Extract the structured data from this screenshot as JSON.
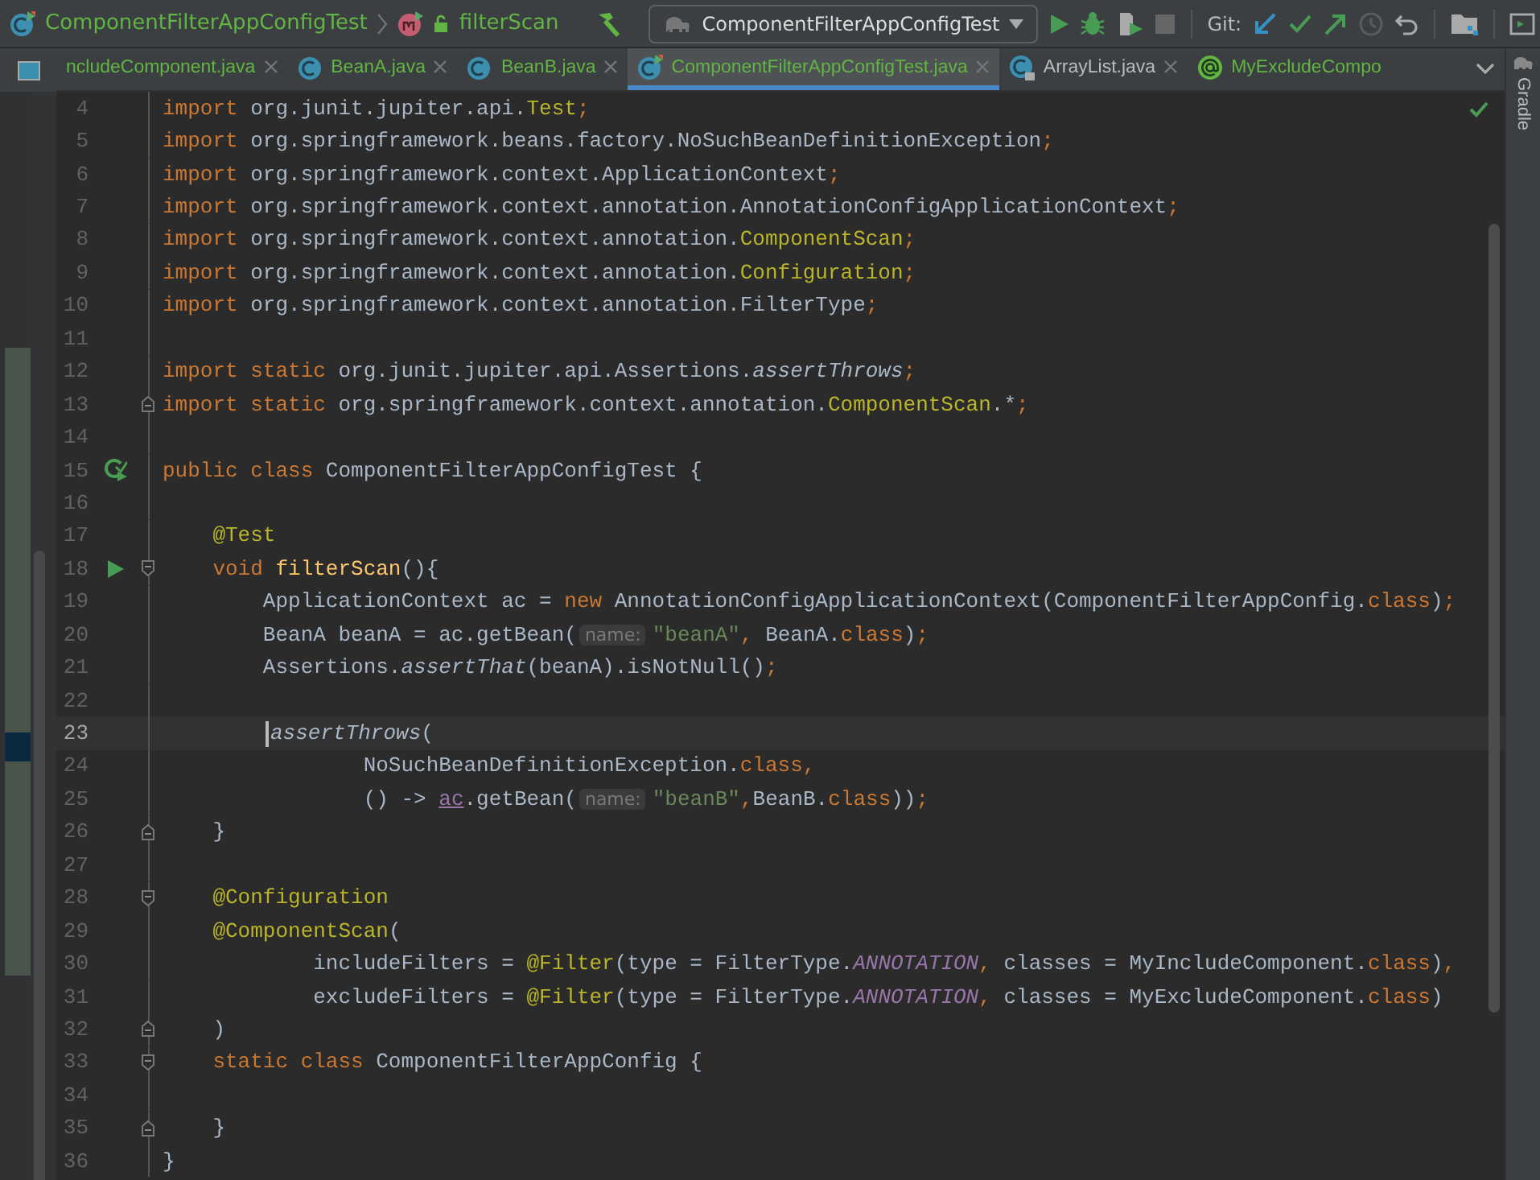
{
  "toolbar": {
    "breadcrumb": [
      {
        "kind": "class",
        "label": "ComponentFilterAppConfigTest"
      },
      {
        "kind": "method",
        "label": "filterScan"
      }
    ],
    "run_config": "ComponentFilterAppConfigTest",
    "git_label": "Git:"
  },
  "tabs": [
    {
      "label": "ncludeComponent.java",
      "selected": false,
      "kind": "plain"
    },
    {
      "label": "BeanA.java",
      "selected": false,
      "kind": "class"
    },
    {
      "label": "BeanB.java",
      "selected": false,
      "kind": "class"
    },
    {
      "label": "ComponentFilterAppConfigTest.java",
      "selected": true,
      "kind": "test"
    },
    {
      "label": "ArrayList.java",
      "selected": false,
      "kind": "library"
    },
    {
      "label": "MyExcludeCompo",
      "selected": false,
      "kind": "annotation"
    }
  ],
  "right_stripe": {
    "label": "Gradle"
  },
  "editor": {
    "lines": [
      {
        "number": "4",
        "tokens": [
          {
            "kind": "keyword",
            "text": "import "
          },
          {
            "kind": "plain",
            "text": "org.junit.jupiter.api."
          },
          {
            "kind": "annotation",
            "text": "Test"
          },
          {
            "kind": "keyword",
            "text": ";"
          }
        ]
      },
      {
        "number": "5",
        "tokens": [
          {
            "kind": "keyword",
            "text": "import "
          },
          {
            "kind": "plain",
            "text": "org.springframework.beans.factory.NoSuchBeanDefinitionException"
          },
          {
            "kind": "keyword",
            "text": ";"
          }
        ]
      },
      {
        "number": "6",
        "tokens": [
          {
            "kind": "keyword",
            "text": "import "
          },
          {
            "kind": "plain",
            "text": "org.springframework.context.ApplicationContext"
          },
          {
            "kind": "keyword",
            "text": ";"
          }
        ]
      },
      {
        "number": "7",
        "tokens": [
          {
            "kind": "keyword",
            "text": "import "
          },
          {
            "kind": "plain",
            "text": "org.springframework.context.annotation.AnnotationConfigApplicationContext"
          },
          {
            "kind": "keyword",
            "text": ";"
          }
        ]
      },
      {
        "number": "8",
        "tokens": [
          {
            "kind": "keyword",
            "text": "import "
          },
          {
            "kind": "plain",
            "text": "org.springframework.context.annotation."
          },
          {
            "kind": "annotation",
            "text": "ComponentScan"
          },
          {
            "kind": "keyword",
            "text": ";"
          }
        ]
      },
      {
        "number": "9",
        "tokens": [
          {
            "kind": "keyword",
            "text": "import "
          },
          {
            "kind": "plain",
            "text": "org.springframework.context.annotation."
          },
          {
            "kind": "annotation",
            "text": "Configuration"
          },
          {
            "kind": "keyword",
            "text": ";"
          }
        ]
      },
      {
        "number": "10",
        "tokens": [
          {
            "kind": "keyword",
            "text": "import "
          },
          {
            "kind": "plain",
            "text": "org.springframework.context.annotation.FilterType"
          },
          {
            "kind": "keyword",
            "text": ";"
          }
        ]
      },
      {
        "number": "11"
      },
      {
        "number": "12",
        "tokens": [
          {
            "kind": "keyword",
            "text": "import static "
          },
          {
            "kind": "plain",
            "text": "org.junit.jupiter.api.Assertions."
          },
          {
            "kind": "italic",
            "text": "assertThrows"
          },
          {
            "kind": "keyword",
            "text": ";"
          }
        ]
      },
      {
        "number": "13",
        "fold": {
          "kind": "end"
        },
        "tokens": [
          {
            "kind": "keyword",
            "text": "import static "
          },
          {
            "kind": "plain",
            "text": "org.springframework.context.annotation."
          },
          {
            "kind": "annotation",
            "text": "ComponentScan"
          },
          {
            "kind": "plain",
            "text": ".*"
          },
          {
            "kind": "keyword",
            "text": ";"
          }
        ]
      },
      {
        "number": "14"
      },
      {
        "number": "15",
        "gutter": {
          "kind": "run-class"
        },
        "tokens": [
          {
            "kind": "keyword",
            "text": "public class "
          },
          {
            "kind": "plain",
            "text": "ComponentFilterAppConfigTest {"
          }
        ]
      },
      {
        "number": "16"
      },
      {
        "number": "17",
        "tokens": [
          {
            "kind": "annotation",
            "text": "    @Test"
          }
        ]
      },
      {
        "number": "18",
        "gutter": {
          "kind": "run"
        },
        "fold": {
          "kind": "start"
        },
        "tokens": [
          {
            "kind": "keyword",
            "text": "    void "
          },
          {
            "kind": "method",
            "text": "filterScan"
          },
          {
            "kind": "plain",
            "text": "(){"
          }
        ]
      },
      {
        "number": "19",
        "tokens": [
          {
            "kind": "plain",
            "text": "        ApplicationContext ac = "
          },
          {
            "kind": "keyword",
            "text": "new "
          },
          {
            "kind": "plain",
            "text": "AnnotationConfigApplicationContext(ComponentFilterAppConfig."
          },
          {
            "kind": "keyword",
            "text": "class"
          },
          {
            "kind": "plain",
            "text": ")"
          },
          {
            "kind": "keyword",
            "text": ";"
          }
        ]
      },
      {
        "number": "20",
        "tokens": [
          {
            "kind": "plain",
            "text": "        BeanA beanA = ac.getBean("
          },
          {
            "kind": "hint",
            "text": "name:"
          },
          {
            "kind": "string",
            "text": "\"beanA\""
          },
          {
            "kind": "keyword",
            "text": ", "
          },
          {
            "kind": "plain",
            "text": "BeanA."
          },
          {
            "kind": "keyword",
            "text": "class"
          },
          {
            "kind": "plain",
            "text": ")"
          },
          {
            "kind": "keyword",
            "text": ";"
          }
        ]
      },
      {
        "number": "21",
        "tokens": [
          {
            "kind": "plain",
            "text": "        Assertions."
          },
          {
            "kind": "italic",
            "text": "assertThat"
          },
          {
            "kind": "plain",
            "text": "(beanA).isNotNull()"
          },
          {
            "kind": "keyword",
            "text": ";"
          }
        ]
      },
      {
        "number": "22"
      },
      {
        "number": "23",
        "current": true,
        "tokens": [
          {
            "kind": "caret"
          },
          {
            "kind": "italic",
            "text": "assertThrows"
          },
          {
            "kind": "plain",
            "text": "("
          }
        ]
      },
      {
        "number": "24",
        "tokens": [
          {
            "kind": "plain",
            "text": "                NoSuchBeanDefinitionException."
          },
          {
            "kind": "keyword",
            "text": "class,"
          }
        ]
      },
      {
        "number": "25",
        "tokens": [
          {
            "kind": "plain",
            "text": "                () -> "
          },
          {
            "kind": "field",
            "text": "ac"
          },
          {
            "kind": "plain",
            "text": ".getBean("
          },
          {
            "kind": "hint",
            "text": "name:"
          },
          {
            "kind": "string",
            "text": "\"beanB\""
          },
          {
            "kind": "keyword",
            "text": ","
          },
          {
            "kind": "plain",
            "text": "BeanB."
          },
          {
            "kind": "keyword",
            "text": "class"
          },
          {
            "kind": "plain",
            "text": "))"
          },
          {
            "kind": "keyword",
            "text": ";"
          }
        ]
      },
      {
        "number": "26",
        "fold": {
          "kind": "end"
        },
        "tokens": [
          {
            "kind": "plain",
            "text": "    }"
          }
        ]
      },
      {
        "number": "27"
      },
      {
        "number": "28",
        "fold": {
          "kind": "start"
        },
        "tokens": [
          {
            "kind": "annotation",
            "text": "    @Configuration"
          }
        ]
      },
      {
        "number": "29",
        "tokens": [
          {
            "kind": "annotation",
            "text": "    @ComponentScan"
          },
          {
            "kind": "plain",
            "text": "("
          }
        ]
      },
      {
        "number": "30",
        "tokens": [
          {
            "kind": "plain",
            "text": "            includeFilters = "
          },
          {
            "kind": "annotation",
            "text": "@Filter"
          },
          {
            "kind": "plain",
            "text": "(type = FilterType."
          },
          {
            "kind": "constant",
            "text": "ANNOTATION"
          },
          {
            "kind": "keyword",
            "text": ", "
          },
          {
            "kind": "plain",
            "text": "classes = MyIncludeComponent."
          },
          {
            "kind": "keyword",
            "text": "class"
          },
          {
            "kind": "plain",
            "text": ")"
          },
          {
            "kind": "keyword",
            "text": ","
          }
        ]
      },
      {
        "number": "31",
        "tokens": [
          {
            "kind": "plain",
            "text": "            excludeFilters = "
          },
          {
            "kind": "annotation",
            "text": "@Filter"
          },
          {
            "kind": "plain",
            "text": "(type = FilterType."
          },
          {
            "kind": "constant",
            "text": "ANNOTATION"
          },
          {
            "kind": "keyword",
            "text": ", "
          },
          {
            "kind": "plain",
            "text": "classes = MyExcludeComponent."
          },
          {
            "kind": "keyword",
            "text": "class"
          },
          {
            "kind": "plain",
            "text": ")"
          }
        ]
      },
      {
        "number": "32",
        "fold": {
          "kind": "end"
        },
        "tokens": [
          {
            "kind": "plain",
            "text": "    )"
          }
        ]
      },
      {
        "number": "33",
        "fold": {
          "kind": "start"
        },
        "tokens": [
          {
            "kind": "keyword",
            "text": "    static class "
          },
          {
            "kind": "plain",
            "text": "ComponentFilterAppConfig {"
          }
        ]
      },
      {
        "number": "34"
      },
      {
        "number": "35",
        "fold": {
          "kind": "end"
        },
        "tokens": [
          {
            "kind": "plain",
            "text": "    }"
          }
        ]
      },
      {
        "number": "36",
        "tokens": [
          {
            "kind": "plain",
            "text": "}"
          }
        ]
      }
    ]
  }
}
